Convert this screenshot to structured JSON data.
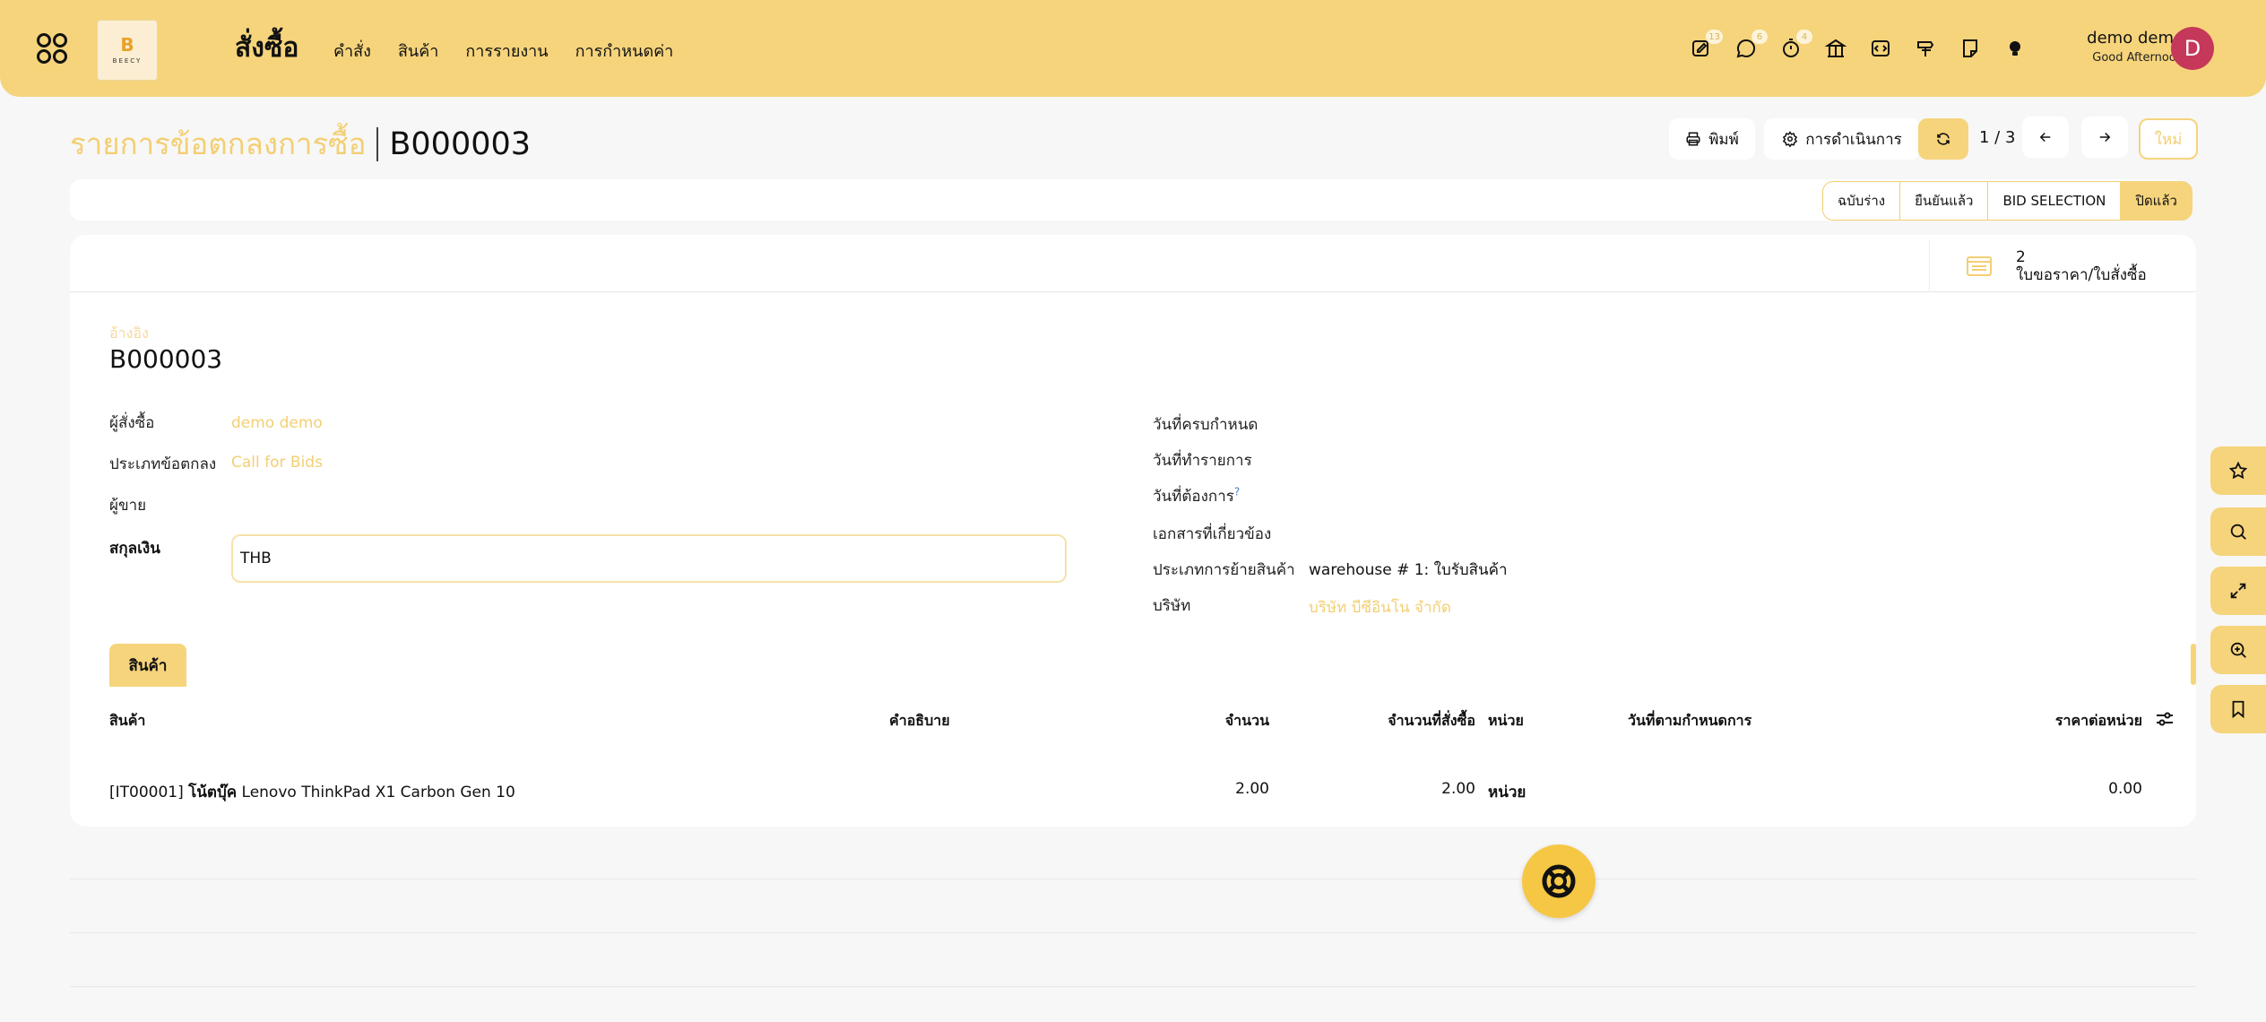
{
  "navbar": {
    "logo_letter": "B",
    "logo_text": "BEECY",
    "app_title": "สั่งซื้อ",
    "menu": [
      {
        "label": "คำสั่ง"
      },
      {
        "label": "สินค้า"
      },
      {
        "label": "การรายงาน"
      },
      {
        "label": "การกำหนดค่า"
      }
    ],
    "badges": {
      "activity": "13",
      "messages": "6",
      "timer": "4"
    },
    "user_name": "demo demo",
    "greeting": "Good Afternoon",
    "avatar_initial": "D",
    "accent_color": "#f6d47c"
  },
  "control": {
    "breadcrumb_parent": "รายการข้อตกลงการซื้อ",
    "breadcrumb_current": "B000003",
    "print_label": "พิมพ์",
    "action_label": "การดำเนินการ",
    "pager": "1 / 3",
    "new_label": "ใหม่"
  },
  "stages": [
    {
      "label": "ฉบับร่าง",
      "active": false
    },
    {
      "label": "ยืนยันแล้ว",
      "active": false
    },
    {
      "label": "BID SELECTION",
      "active": false
    },
    {
      "label": "ปิดแล้ว",
      "active": true
    }
  ],
  "smart_button": {
    "value": "2",
    "label": "ใบขอราคา/ใบสั่งซื้อ"
  },
  "form": {
    "reference_label": "อ้างอิง",
    "reference_value": "B000003",
    "left": {
      "buyer_label": "ผู้สั่งซื้อ",
      "buyer_value": "demo demo",
      "agreement_type_label": "ประเภทข้อตกลง",
      "agreement_type_value": "Call for Bids",
      "vendor_label": "ผู้ขาย",
      "currency_label": "สกุลเงิน",
      "currency_value": "THB"
    },
    "right": {
      "deadline_label": "วันที่ครบกำหนด",
      "order_date_label": "วันที่ทำรายการ",
      "delivery_date_label": "วันที่ต้องการ",
      "help_mark": "?",
      "source_doc_label": "เอกสารที่เกี่ยวข้อง",
      "picking_type_label": "ประเภทการย้ายสินค้า",
      "picking_type_value": "warehouse # 1: ใบรับสินค้า",
      "company_label": "บริษัท",
      "company_value": "บริษัท บีซีอินโน จำกัด"
    }
  },
  "lines": {
    "tab_label": "สินค้า",
    "headers": {
      "product": "สินค้า",
      "description": "คำอธิบาย",
      "quantity": "จำนวน",
      "ordered_qty": "จำนวนที่สั่งซื้อ",
      "uom": "หน่วย",
      "scheduled_date": "วันที่ตามกำหนดการ",
      "unit_price": "ราคาต่อหน่วย"
    },
    "rows": [
      {
        "product_code": "[IT00001]",
        "product_name_bold": "โน้ตบุ๊ค",
        "product_name_rest": "Lenovo ThinkPad X1 Carbon Gen 10",
        "quantity": "2.00",
        "ordered_qty": "2.00",
        "uom": "หน่วย",
        "unit_price": "0.00"
      }
    ]
  }
}
